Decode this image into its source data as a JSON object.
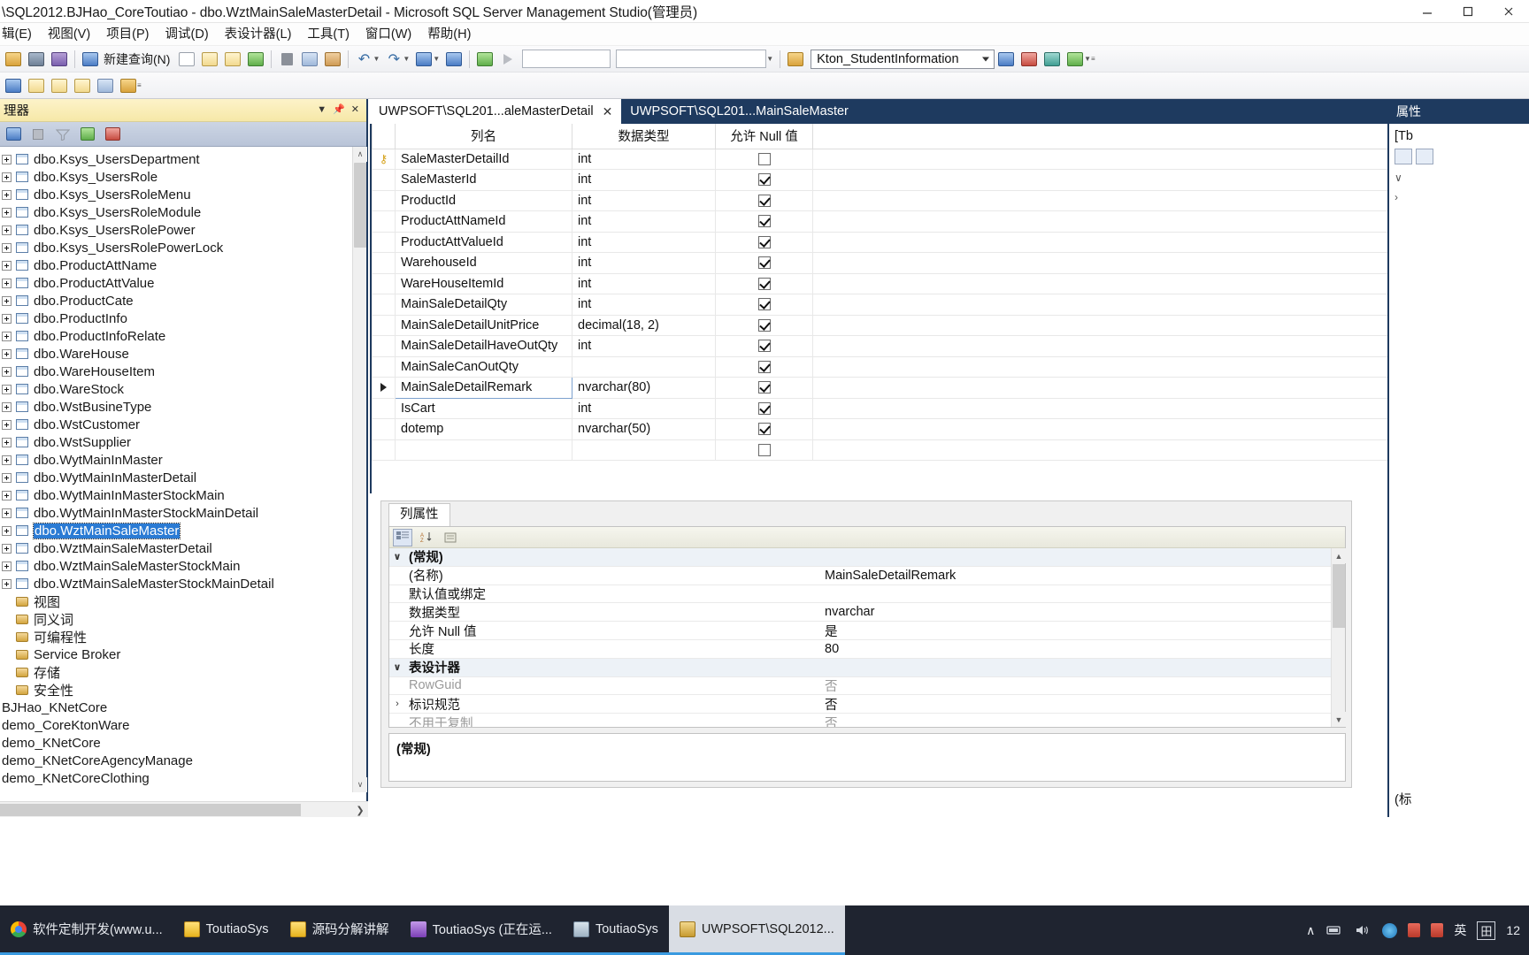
{
  "window": {
    "title": "\\SQL2012.BJHao_CoreToutiao - dbo.WztMainSaleMasterDetail - Microsoft SQL Server Management Studio(管理员)",
    "minimize_label": "—",
    "maximize_label": "❐",
    "close_label": "✕"
  },
  "menubar": {
    "items": [
      {
        "label": "辑(E)"
      },
      {
        "label": "视图(V)"
      },
      {
        "label": "项目(P)"
      },
      {
        "label": "调试(D)"
      },
      {
        "label": "表设计器(L)"
      },
      {
        "label": "工具(T)"
      },
      {
        "label": "窗口(W)"
      },
      {
        "label": "帮助(H)"
      }
    ]
  },
  "toolbar": {
    "new_query_label": "新建查询(N)",
    "database_combo_value": "Kton_StudentInformation",
    "icons": [
      "open-folder-icon",
      "save-icon",
      "save-all-icon",
      "connect-icon",
      "new-query-icon",
      "new-db-query-icon",
      "new-analysis-query-icon",
      "new-mdx-query-icon",
      "cut-icon",
      "copy-icon",
      "paste-icon",
      "undo-icon",
      "redo-icon",
      "navigate-icon",
      "debug-icon",
      "execute-icon",
      "play-icon"
    ],
    "icons_row2": [
      "relationships-icon",
      "manage-indexes-icon",
      "manage-checks-icon",
      "manage-xml-indexes-icon",
      "generate-change-script-icon",
      "set-primary-key-icon"
    ]
  },
  "object_explorer": {
    "title": "理器",
    "toolbar_icons": [
      "connect-icon",
      "disconnect-icon",
      "filter-icon",
      "refresh-icon",
      "sync-icon"
    ],
    "scroll_up": "∧",
    "scroll_down": "∨",
    "scroll_right": "❯",
    "tree": [
      {
        "label": "dbo.Ksys_UsersDepartment",
        "type": "table",
        "selected": false
      },
      {
        "label": "dbo.Ksys_UsersRole",
        "type": "table",
        "selected": false
      },
      {
        "label": "dbo.Ksys_UsersRoleMenu",
        "type": "table",
        "selected": false
      },
      {
        "label": "dbo.Ksys_UsersRoleModule",
        "type": "table",
        "selected": false
      },
      {
        "label": "dbo.Ksys_UsersRolePower",
        "type": "table",
        "selected": false
      },
      {
        "label": "dbo.Ksys_UsersRolePowerLock",
        "type": "table",
        "selected": false
      },
      {
        "label": "dbo.ProductAttName",
        "type": "table",
        "selected": false
      },
      {
        "label": "dbo.ProductAttValue",
        "type": "table",
        "selected": false
      },
      {
        "label": "dbo.ProductCate",
        "type": "table",
        "selected": false
      },
      {
        "label": "dbo.ProductInfo",
        "type": "table",
        "selected": false
      },
      {
        "label": "dbo.ProductInfoRelate",
        "type": "table",
        "selected": false
      },
      {
        "label": "dbo.WareHouse",
        "type": "table",
        "selected": false
      },
      {
        "label": "dbo.WareHouseItem",
        "type": "table",
        "selected": false
      },
      {
        "label": "dbo.WareStock",
        "type": "table",
        "selected": false
      },
      {
        "label": "dbo.WstBusineType",
        "type": "table",
        "selected": false
      },
      {
        "label": "dbo.WstCustomer",
        "type": "table",
        "selected": false
      },
      {
        "label": "dbo.WstSupplier",
        "type": "table",
        "selected": false
      },
      {
        "label": "dbo.WytMainInMaster",
        "type": "table",
        "selected": false
      },
      {
        "label": "dbo.WytMainInMasterDetail",
        "type": "table",
        "selected": false
      },
      {
        "label": "dbo.WytMainInMasterStockMain",
        "type": "table",
        "selected": false
      },
      {
        "label": "dbo.WytMainInMasterStockMainDetail",
        "type": "table",
        "selected": false
      },
      {
        "label": "dbo.WztMainSaleMaster",
        "type": "table",
        "selected": true
      },
      {
        "label": "dbo.WztMainSaleMasterDetail",
        "type": "table",
        "selected": false
      },
      {
        "label": "dbo.WztMainSaleMasterStockMain",
        "type": "table",
        "selected": false
      },
      {
        "label": "dbo.WztMainSaleMasterStockMainDetail",
        "type": "table",
        "selected": false
      },
      {
        "label": "视图",
        "type": "folder",
        "selected": false
      },
      {
        "label": "同义词",
        "type": "folder",
        "selected": false
      },
      {
        "label": "可编程性",
        "type": "folder",
        "selected": false
      },
      {
        "label": "Service Broker",
        "type": "folder",
        "selected": false
      },
      {
        "label": "存储",
        "type": "folder",
        "selected": false
      },
      {
        "label": "安全性",
        "type": "folder",
        "selected": false
      },
      {
        "label": "BJHao_KNetCore",
        "type": "plain",
        "selected": false
      },
      {
        "label": "demo_CoreKtonWare",
        "type": "plain",
        "selected": false
      },
      {
        "label": "demo_KNetCore",
        "type": "plain",
        "selected": false
      },
      {
        "label": "demo_KNetCoreAgencyManage",
        "type": "plain",
        "selected": false
      },
      {
        "label": "demo_KNetCoreClothing",
        "type": "plain",
        "selected": false
      }
    ]
  },
  "tabs": [
    {
      "label": "UWPSOFT\\SQL201...aleMasterDetail",
      "active": true,
      "close": "✕"
    },
    {
      "label": "UWPSOFT\\SQL201...MainSaleMaster",
      "active": false,
      "close": ""
    }
  ],
  "designer": {
    "columns": [
      "列名",
      "数据类型",
      "允许 Null 值"
    ],
    "rows": [
      {
        "name": "SaleMasterDetailId",
        "type": "int",
        "nullable": false,
        "pk": true,
        "current": false
      },
      {
        "name": "SaleMasterId",
        "type": "int",
        "nullable": true,
        "pk": false,
        "current": false
      },
      {
        "name": "ProductId",
        "type": "int",
        "nullable": true,
        "pk": false,
        "current": false
      },
      {
        "name": "ProductAttNameId",
        "type": "int",
        "nullable": true,
        "pk": false,
        "current": false
      },
      {
        "name": "ProductAttValueId",
        "type": "int",
        "nullable": true,
        "pk": false,
        "current": false
      },
      {
        "name": "WarehouseId",
        "type": "int",
        "nullable": true,
        "pk": false,
        "current": false
      },
      {
        "name": "WareHouseItemId",
        "type": "int",
        "nullable": true,
        "pk": false,
        "current": false
      },
      {
        "name": "MainSaleDetailQty",
        "type": "int",
        "nullable": true,
        "pk": false,
        "current": false
      },
      {
        "name": "MainSaleDetailUnitPrice",
        "type": "decimal(18, 2)",
        "nullable": true,
        "pk": false,
        "current": false
      },
      {
        "name": "MainSaleDetailHaveOutQty",
        "type": "int",
        "nullable": true,
        "pk": false,
        "current": false
      },
      {
        "name": "MainSaleCanOutQty",
        "type": "",
        "nullable": true,
        "pk": false,
        "current": false
      },
      {
        "name": "MainSaleDetailRemark",
        "type": "nvarchar(80)",
        "nullable": true,
        "pk": false,
        "current": true
      },
      {
        "name": "IsCart",
        "type": "int",
        "nullable": true,
        "pk": false,
        "current": false
      },
      {
        "name": "dotemp",
        "type": "nvarchar(50)",
        "nullable": true,
        "pk": false,
        "current": false
      },
      {
        "name": "",
        "type": "",
        "nullable": false,
        "pk": false,
        "current": false
      }
    ]
  },
  "properties": {
    "tab_label": "列属性",
    "toolbar_icons": [
      "categorized-icon",
      "alphabetical-icon",
      "property-pages-icon"
    ],
    "rows": [
      {
        "kind": "category",
        "key": "(常规)",
        "value": "",
        "expander": "∨"
      },
      {
        "kind": "prop",
        "key": "(名称)",
        "value": "MainSaleDetailRemark",
        "expander": ""
      },
      {
        "kind": "prop",
        "key": "默认值或绑定",
        "value": "",
        "expander": ""
      },
      {
        "kind": "prop",
        "key": "数据类型",
        "value": "nvarchar",
        "expander": ""
      },
      {
        "kind": "prop",
        "key": "允许 Null 值",
        "value": "是",
        "expander": ""
      },
      {
        "kind": "prop",
        "key": "长度",
        "value": "80",
        "expander": ""
      },
      {
        "kind": "category",
        "key": "表设计器",
        "value": "",
        "expander": "∨"
      },
      {
        "kind": "dim",
        "key": "RowGuid",
        "value": "否",
        "expander": ""
      },
      {
        "kind": "prop",
        "key": "标识规范",
        "value": "否",
        "expander": "›"
      },
      {
        "kind": "dim",
        "key": "不用于复制",
        "value": "否",
        "expander": ""
      }
    ],
    "description_title": "(常规)"
  },
  "right_panel": {
    "tab_label": "属性",
    "sub_label": "[Tb",
    "chevron_down": "∨",
    "chevron_right": "›",
    "footer_label": "(标"
  },
  "taskbar": {
    "items": [
      {
        "label": "软件定制开发(www.u...",
        "icon": "chrome-icon",
        "active": false,
        "running": true
      },
      {
        "label": "ToutiaoSys",
        "icon": "notepad-icon",
        "active": false,
        "running": true
      },
      {
        "label": "源码分解讲解",
        "icon": "notepad-icon",
        "active": false,
        "running": true
      },
      {
        "label": "ToutiaoSys (正在运...",
        "icon": "visualstudio-icon",
        "active": false,
        "running": true
      },
      {
        "label": "ToutiaoSys",
        "icon": "explorer-icon",
        "active": false,
        "running": true
      },
      {
        "label": "UWPSOFT\\SQL2012...",
        "icon": "ssms-icon",
        "active": true,
        "running": true
      }
    ],
    "tray": {
      "show_hidden": "∧",
      "network_icon": "network-icon",
      "volume_icon": "volume-icon",
      "blue_icon": "app-blue-icon",
      "red_icon_1": "app-red-icon",
      "red_icon_2": "app-red2-icon",
      "ime_label": "英",
      "ime_box_label": "田",
      "clock": "12"
    }
  },
  "colors": {
    "accent_dark": "#1e3a5f",
    "selection_blue": "#2b7bd4",
    "header_yellow": "#f6e8a8",
    "taskbar": "#1f2430"
  }
}
